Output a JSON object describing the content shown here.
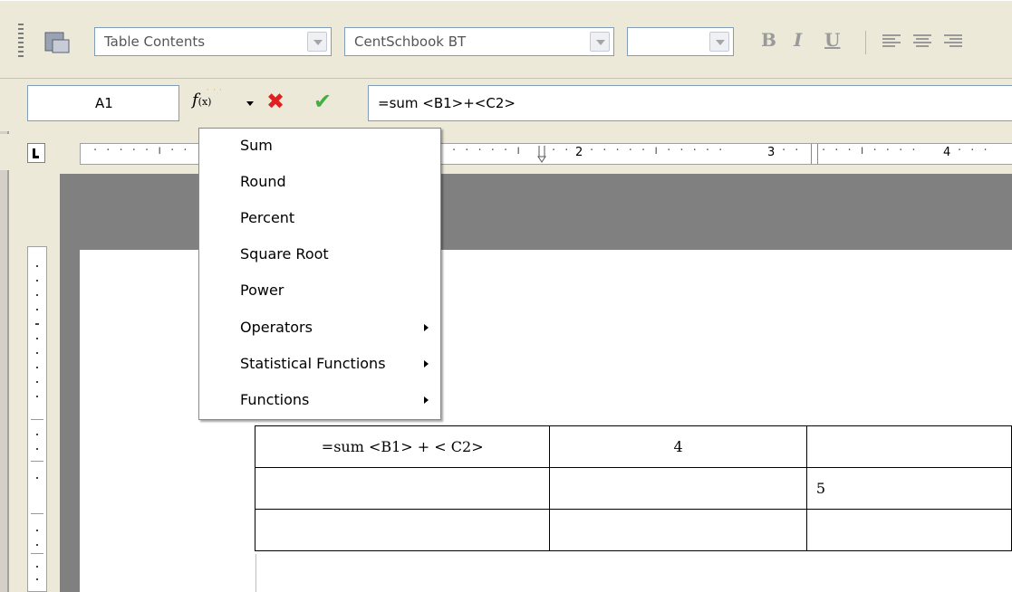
{
  "toolbar": {
    "paragraph_style": "Table Contents",
    "font_name": "CentSchbook BT",
    "font_size": "",
    "bold_label": "B",
    "italic_label": "I",
    "underline_label": "U"
  },
  "formula_bar": {
    "cell_reference": "A1",
    "fx_label": "f(x)",
    "formula": "=sum <B1>+<C2>"
  },
  "ruler": {
    "marks": [
      "2",
      "3",
      "4"
    ]
  },
  "formula_menu": {
    "items": [
      {
        "label": "Sum",
        "submenu": false
      },
      {
        "label": "Round",
        "submenu": false
      },
      {
        "label": "Percent",
        "submenu": false
      },
      {
        "label": "Square Root",
        "submenu": false
      },
      {
        "label": "Power",
        "submenu": false
      },
      {
        "label": "Operators",
        "submenu": true
      },
      {
        "label": "Statistical Functions",
        "submenu": true
      },
      {
        "label": "Functions",
        "submenu": true
      }
    ]
  },
  "table": {
    "rows": [
      [
        "=sum <B1> + < C2>",
        "4",
        ""
      ],
      [
        "",
        "",
        "5"
      ],
      [
        "",
        "",
        ""
      ]
    ]
  },
  "colors": {
    "cancel": "#e02020",
    "accept": "#40b040",
    "workspace": "#808080"
  }
}
